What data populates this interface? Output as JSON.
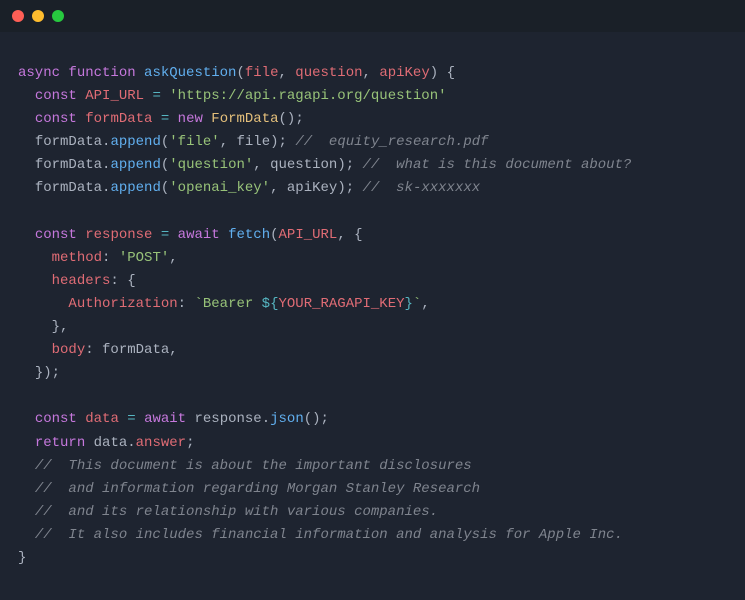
{
  "code": {
    "l1": {
      "async": "async",
      "function": "function",
      "fnName": "askQuestion",
      "p1": "file",
      "p2": "question",
      "p3": "apiKey",
      "brace": "{"
    },
    "l2": {
      "const": "const",
      "name": "API_URL",
      "eq": "=",
      "str": "'https://api.ragapi.org/question'"
    },
    "l3": {
      "const": "const",
      "name": "formData",
      "eq": "=",
      "new": "new",
      "ctor": "FormData",
      "call": "();"
    },
    "l4": {
      "obj": "formData",
      "dot": ".",
      "method": "append",
      "open": "(",
      "arg1": "'file'",
      "comma": ", ",
      "arg2": "file",
      "close": ");",
      "comment": "//  equity_research.pdf"
    },
    "l5": {
      "obj": "formData",
      "dot": ".",
      "method": "append",
      "open": "(",
      "arg1": "'question'",
      "comma": ", ",
      "arg2": "question",
      "close": ");",
      "comment": "//  what is this document about?"
    },
    "l6": {
      "obj": "formData",
      "dot": ".",
      "method": "append",
      "open": "(",
      "arg1": "'openai_key'",
      "comma": ", ",
      "arg2": "apiKey",
      "close": ");",
      "comment": "//  sk-xxxxxxx"
    },
    "l7": {
      "const": "const",
      "name": "response",
      "eq": "=",
      "await": "await",
      "fn": "fetch",
      "open": "(",
      "arg": "API_URL",
      "comma": ", {"
    },
    "l8": {
      "key": "method",
      "colon": ": ",
      "val": "'POST'",
      "comma": ","
    },
    "l9": {
      "key": "headers",
      "colon": ": {"
    },
    "l10": {
      "key": "Authorization",
      "colon": ": ",
      "tick1": "`",
      "str1": "Bearer ",
      "interp1": "${",
      "var": "YOUR_RAGAPI_KEY",
      "interp2": "}",
      "tick2": "`",
      "comma": ","
    },
    "l11": {
      "close": "},"
    },
    "l12": {
      "key": "body",
      "colon": ": ",
      "val": "formData",
      "comma": ","
    },
    "l13": {
      "close": "});"
    },
    "l14": {
      "const": "const",
      "name": "data",
      "eq": "=",
      "await": "await",
      "obj": "response",
      "dot": ".",
      "method": "json",
      "call": "();"
    },
    "l15": {
      "return": "return",
      "obj": "data",
      "dot": ".",
      "prop": "answer",
      "semi": ";"
    },
    "l16": {
      "comment": "//  This document is about the important disclosures"
    },
    "l17": {
      "comment": "//  and information regarding Morgan Stanley Research"
    },
    "l18": {
      "comment": "//  and its relationship with various companies."
    },
    "l19": {
      "comment": "//  It also includes financial information and analysis for Apple Inc."
    },
    "l20": {
      "brace": "}"
    }
  }
}
